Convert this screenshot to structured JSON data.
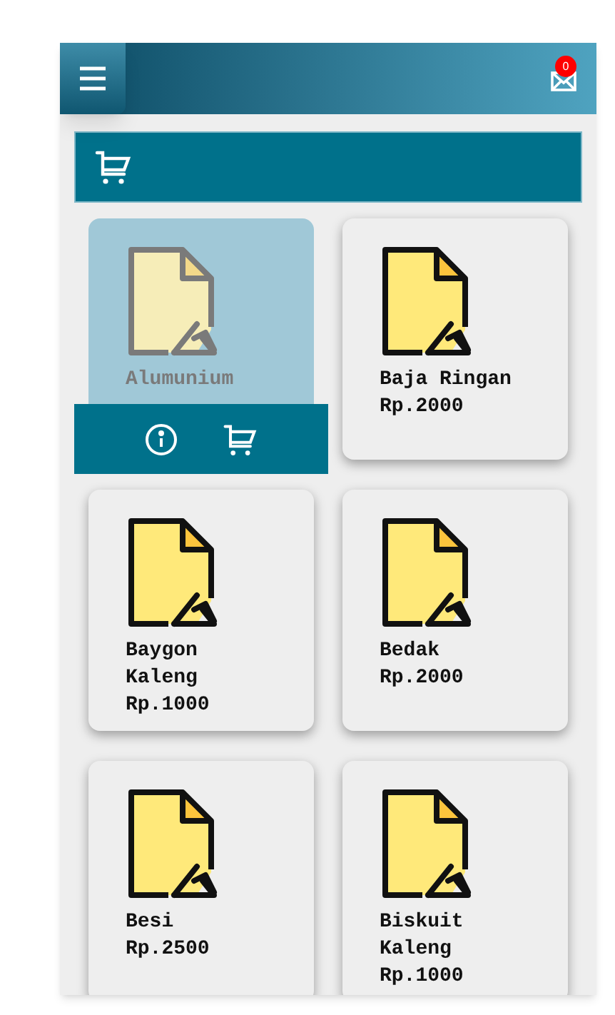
{
  "header": {
    "notification_count": "0"
  },
  "products": [
    {
      "name": "Alumunium",
      "selected": true
    },
    {
      "name": "Baja Ringan",
      "price": "Rp.2000",
      "selected": false
    },
    {
      "name": "Baygon Kaleng",
      "price": "Rp.1000",
      "selected": false
    },
    {
      "name": "Bedak",
      "price": "Rp.2000",
      "selected": false
    },
    {
      "name": "Besi",
      "price": "Rp.2500",
      "selected": false
    },
    {
      "name": "Biskuit Kaleng",
      "price": "Rp.1000",
      "selected": false
    }
  ]
}
